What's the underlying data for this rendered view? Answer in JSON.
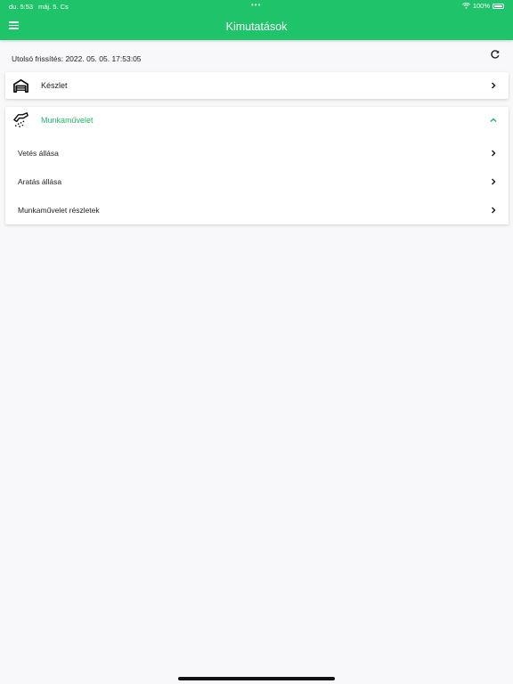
{
  "status_bar": {
    "time": "du. 5:53",
    "date": "máj. 5. Cs",
    "battery": "100%"
  },
  "header": {
    "title": "Kimutatások"
  },
  "refresh": {
    "label": "Utolsó frissítés: 2022. 05. 05. 17:53:05"
  },
  "sections": {
    "stock": {
      "label": "Készlet"
    },
    "operations": {
      "label": "Munkaművelet",
      "items": [
        {
          "label": "Vetés állása"
        },
        {
          "label": "Aratás állása"
        },
        {
          "label": "Munkaművelet részletek"
        }
      ]
    }
  },
  "colors": {
    "accent": "#1fc36a",
    "active_text": "#22b86a"
  },
  "icons": {
    "menu": "menu-icon",
    "refresh": "refresh-icon",
    "stock": "warehouse-icon",
    "operations": "seeding-icon",
    "expand": "chevron-up-icon",
    "row": "chevron-right-icon"
  }
}
